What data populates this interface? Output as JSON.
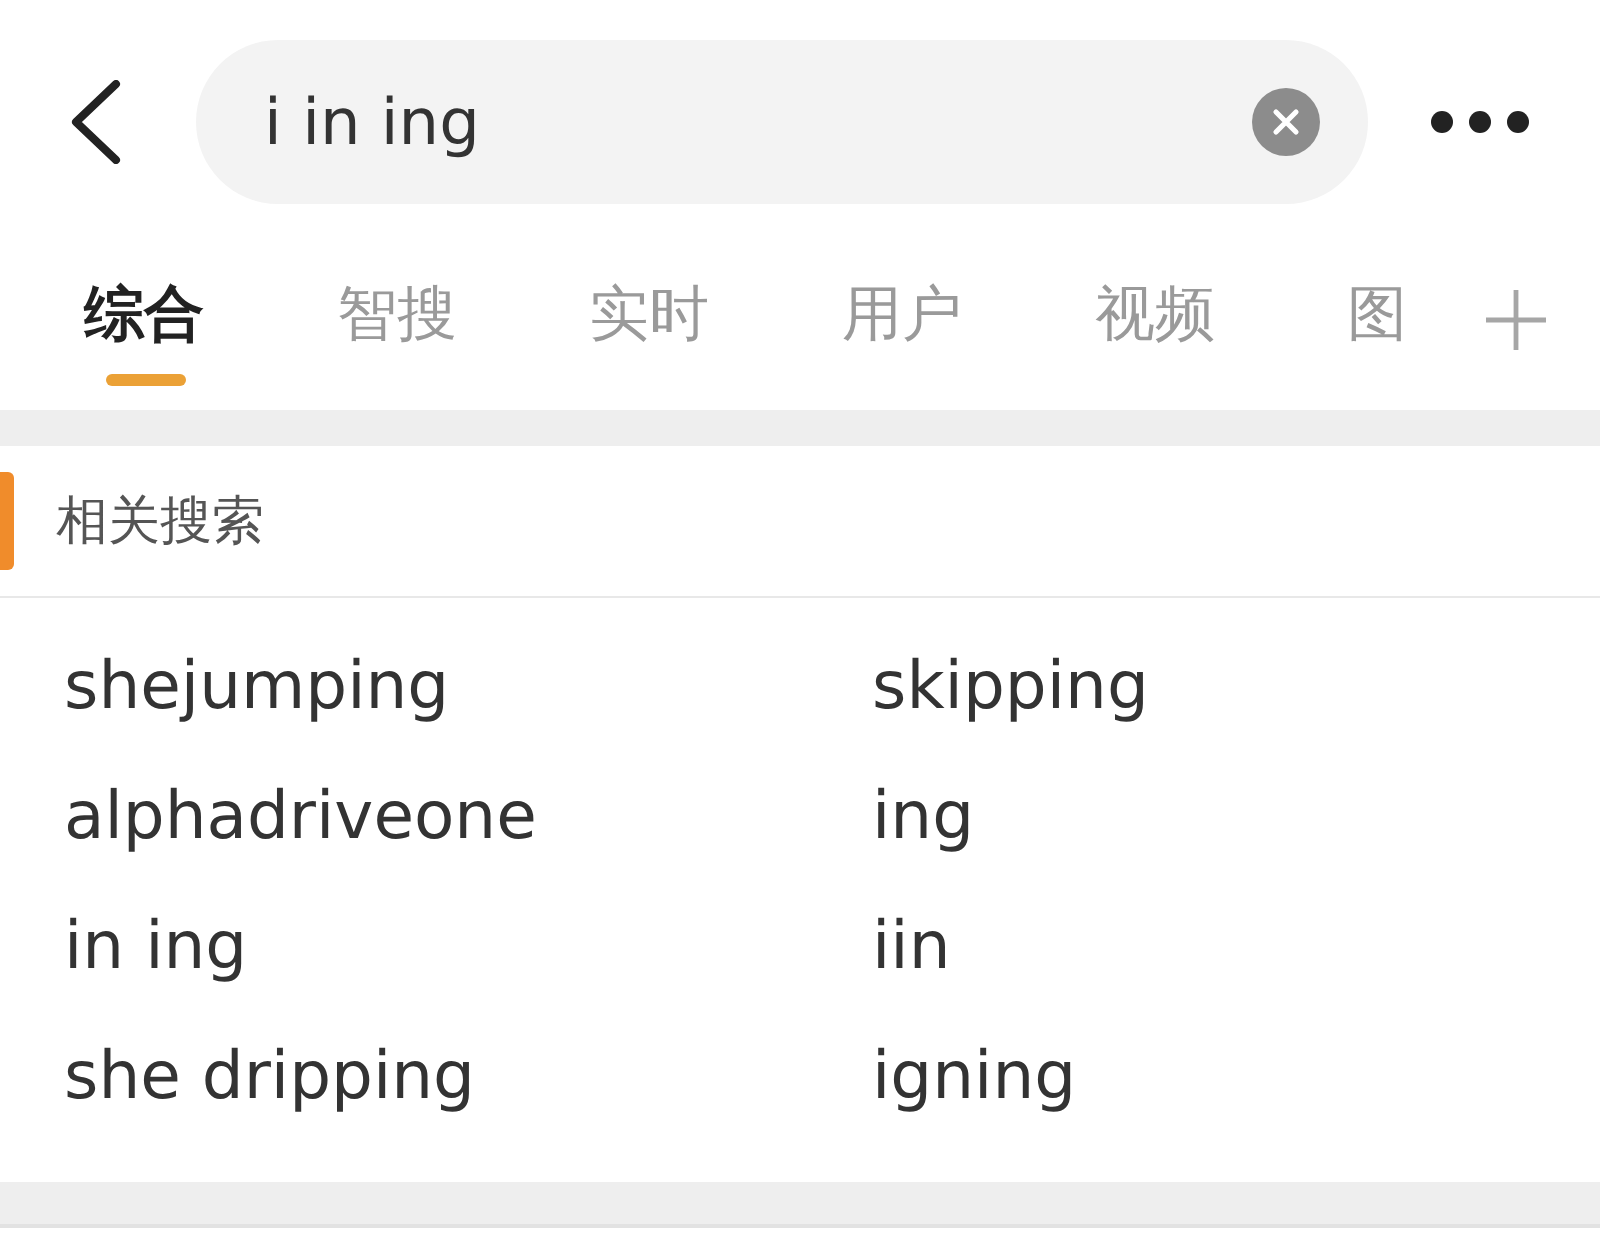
{
  "header": {
    "search": {
      "value": "i in ing"
    }
  },
  "tabs": [
    {
      "label": "综合",
      "selected": true
    },
    {
      "label": "智搜",
      "selected": false
    },
    {
      "label": "实时",
      "selected": false
    },
    {
      "label": "用户",
      "selected": false
    },
    {
      "label": "视频",
      "selected": false
    },
    {
      "label": "图",
      "selected": false
    }
  ],
  "related_searches": {
    "title": "相关搜索",
    "items": [
      "shejumping",
      "skipping",
      "alphadriveone",
      "ing",
      "in ing",
      "iin",
      "she dripping",
      "igning"
    ]
  }
}
